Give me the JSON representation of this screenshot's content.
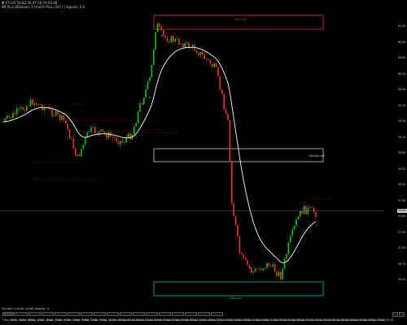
{
  "header": {
    "line1": "▼ XTI,H1 56.82 56.97 56.79 56.88",
    "line2": "BB Plus (Boolean: 1 tmo/rt Plus=16C)  | Signals: 0.0"
  },
  "zones": {
    "top_label": "Premium",
    "mid_label": "Equilibrium",
    "bottom_label": "Discount"
  },
  "colors": {
    "background": "#000000",
    "bull_candle": "#19c119",
    "bear_candle": "#e83a2a",
    "trend_line": "#ffffff",
    "premium_zone": "#e0303a",
    "equilibrium_zone": "#c8c8c8",
    "discount_zone": "#20b2aa",
    "signal_marker": "#3a8cff"
  },
  "price_axis": {
    "labels": [
      "61.20",
      "60.90",
      "60.60",
      "60.30",
      "60.00",
      "59.70",
      "59.40",
      "59.10",
      "58.80",
      "58.50",
      "58.20",
      "57.90",
      "57.60",
      "57.30",
      "57.00",
      "56.70",
      "56.40"
    ]
  },
  "current_price": "56.88",
  "time_axis": {
    "labels": [
      "7 Nov 2023",
      "8 Nov 04:00",
      "8 Nov 08:00",
      "8 Nov 12:00",
      "8 Nov 16:00",
      "8 Nov 20:00",
      "9 Nov 00:00",
      "9 Nov 04:00",
      "9 Nov 08:00",
      "9 Nov 12:00",
      "9 Nov 16:00",
      "9 Nov 20:00",
      "10 Nov 00:00",
      "10 Nov 04:00",
      "10 Nov 08:00",
      "10 Nov 12:00",
      "10 Nov 16:00",
      "10 Nov 20:00",
      "13 Nov 00:00",
      "13 Nov 04:00",
      "13 Nov 08:00",
      "13 Nov 12:00",
      "13 Nov 16:00",
      "13 Nov 20:00",
      "14 Nov 00:00",
      "14 Nov 04:00",
      "14 Nov 08:00",
      "14 Nov 12:00",
      "14 Nov 16:00",
      "14 Nov 20:00",
      "15 Nov 00:00",
      "15 Nov 04:00",
      "15 Nov 08:00",
      "15 Nov 12:00",
      "15 Nov 16:00",
      "15 Nov 20:00",
      "16 Nov 00:00",
      "16 Nov 04:00",
      "16 Nov 08:00",
      "16 Nov 12:00",
      "16 Nov 16:00",
      "16 Nov 20:00",
      "17 Nov 00:00"
    ]
  },
  "status_bar": {
    "text": "Symbol change: profit display: 4"
  },
  "bottom_tabs": [
    "XTI,H1",
    "EURUSD,H1",
    "GBPUSD,H1",
    "USDJPY,H1",
    "USDCHF,H1",
    "AUDUSD,H1",
    "USDCAD,H1",
    "NZDUSD,H1",
    "XAUUSD,H1",
    "EURJPY,H1",
    "GBPJPY,H1",
    "EURGBP,H1",
    "US30,H1",
    "SPX500,H1",
    "NAS100,H1",
    "GER40,H1",
    "BTCUSD,H1"
  ]
}
